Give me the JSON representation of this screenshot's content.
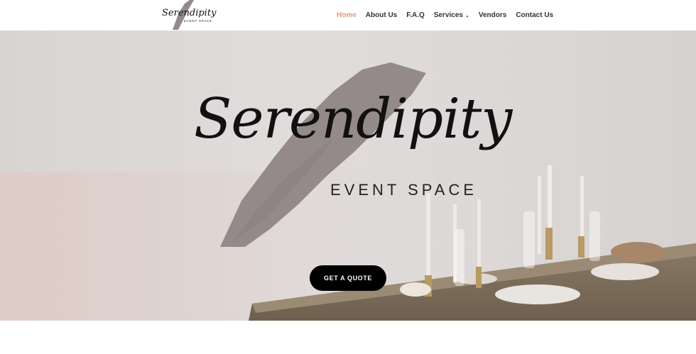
{
  "header": {
    "logo": {
      "script": "Serendipity",
      "tagline": "EVENT SPACE"
    },
    "nav": [
      {
        "label": "Home",
        "active": true
      },
      {
        "label": "About Us",
        "active": false
      },
      {
        "label": "F.A.Q",
        "active": false
      },
      {
        "label": "Services",
        "active": false,
        "has_dropdown": true
      },
      {
        "label": "Vendors",
        "active": false
      },
      {
        "label": "Contact Us",
        "active": false
      }
    ]
  },
  "hero": {
    "title_script": "Serendipity",
    "subtitle": "EVENT SPACE",
    "cta_label": "GET A QUOTE"
  },
  "colors": {
    "accent": "#e39a74",
    "brush": "#938a89",
    "cta_bg": "#000000"
  }
}
